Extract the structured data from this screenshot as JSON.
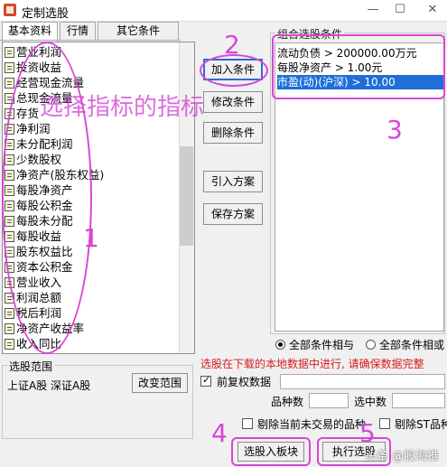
{
  "window": {
    "title": "定制选股",
    "minimize": "—",
    "maximize": "☐",
    "close": "✕"
  },
  "tabs": [
    "基本资料",
    "行情",
    "其它条件"
  ],
  "indicators": [
    "营业利润",
    "投资收益",
    "经营现金流量",
    "总现金流量",
    "存货",
    "净利润",
    "未分配利润",
    "少数股权",
    "净资产(股东权益)",
    "每股净资产",
    "每股公积金",
    "每股未分配",
    "每股收益",
    "股东权益比",
    "资本公积金",
    "营业收入",
    "利润总额",
    "税后利润",
    "净资产收益率",
    "收入同比"
  ],
  "buttons": {
    "add": "加入条件",
    "edit": "修改条件",
    "delete": "删除条件",
    "import": "引入方案",
    "save": "保存方案"
  },
  "conditions": {
    "label": "组合选股条件",
    "rows": [
      "流动负债 > 200000.00万元",
      "每股净资产 > 1.00元",
      "市盈(动)(沪深) > 10.00"
    ],
    "selected_index": 2
  },
  "logic": {
    "all_and": "全部条件相与",
    "all_or": "全部条件相或",
    "selected": "and"
  },
  "scope": {
    "label": "选股范围",
    "value": "上证A股 深证A股",
    "change_btn": "改变范围"
  },
  "notice": "选股在下载的本地数据中进行, 请确保数据完整",
  "options": {
    "fq_label": "前复权数据",
    "fq_checked": true,
    "kinds_label": "品种数",
    "selected_label": "选中数",
    "exclude_untraded": "剔除当前未交易的品种",
    "exclude_st": "剔除ST品种"
  },
  "actions": {
    "to_block": "选股入板块",
    "run": "执行选股"
  },
  "annotations": {
    "n1": "1",
    "n2": "2",
    "n3": "3",
    "n4": "4",
    "n5": "5",
    "hint": "选择指标的指标"
  },
  "watermark": "头条 @股海推"
}
